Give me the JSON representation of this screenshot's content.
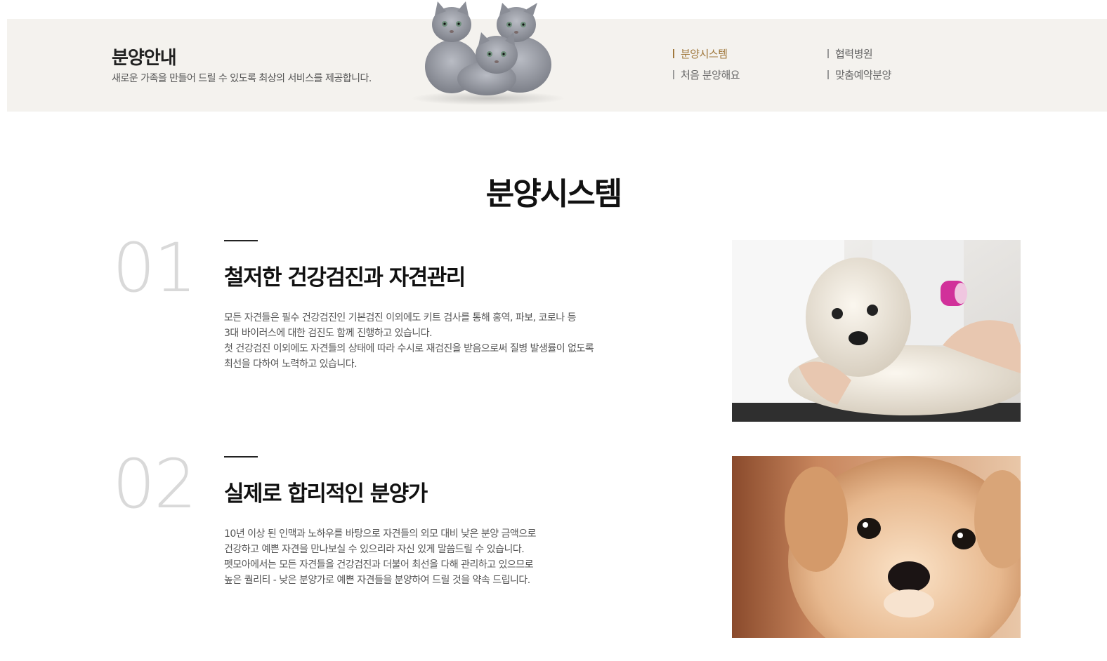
{
  "header": {
    "title": "분양안내",
    "subtitle": "새로운 가족을 만들어 드릴 수 있도록 최상의 서비스를 제공합니다."
  },
  "subnav": {
    "items": [
      {
        "label": "분양시스템",
        "active": true
      },
      {
        "label": "협력병원",
        "active": false
      },
      {
        "label": "처음 분양해요",
        "active": false
      },
      {
        "label": "맞춤예약분양",
        "active": false
      }
    ]
  },
  "section": {
    "title": "분양시스템"
  },
  "features": [
    {
      "number": "01",
      "heading": "철저한 건강검진과 자견관리",
      "lines": [
        "모든 자견들은 필수 건강검진인 기본검진 이외에도 키트 검사를 통해 홍역, 파보, 코로나 등",
        "3대 바이러스에 대한 검진도 함께 진행하고 있습니다.",
        "첫 건강검진 이외에도 자견들의 상태에 따라 수시로 재검진을 받음으로써 질병 발생률이 없도록",
        "최선을 다하여 노력하고 있습니다."
      ],
      "image": "vet-exam-photo"
    },
    {
      "number": "02",
      "heading": "실제로 합리적인 분양가",
      "lines": [
        "10년 이상 된 인맥과 노하우를 바탕으로 자견들의 외모 대비 낮은 분양 금액으로",
        "건강하고 예쁜 자견을 만나보실 수 있으리라 자신 있게 말씀드릴 수 있습니다.",
        "펫모아에서는 모든 자견들을 건강검진과 더불어 최선을 다해 관리하고 있으므로",
        "높은 퀄리티 - 낮은 분양가로 예쁜 자견들을 분양하여 드릴 것을 약속 드립니다."
      ],
      "image": "puppy-photo"
    }
  ],
  "colors": {
    "banner_bg": "#f4f2ee",
    "accent": "#a0783c",
    "number_gray": "#d9d9d9"
  }
}
